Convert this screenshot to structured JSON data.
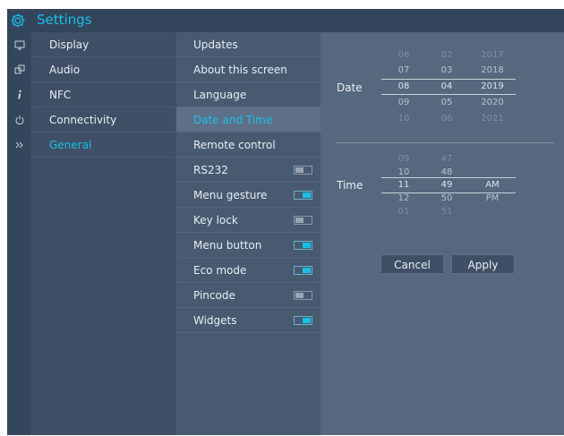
{
  "app": {
    "title": "Settings",
    "title_icon": "gear-icon",
    "accent_color": "#18c0e8"
  },
  "rail": [
    {
      "icon": "display-icon"
    },
    {
      "icon": "audio-icon"
    },
    {
      "icon": "info-icon"
    },
    {
      "icon": "power-icon"
    },
    {
      "icon": "chevron-double-right-icon"
    }
  ],
  "categories": [
    {
      "label": "Display"
    },
    {
      "label": "Audio"
    },
    {
      "label": "NFC"
    },
    {
      "label": "Connectivity"
    },
    {
      "label": "General",
      "active": true
    }
  ],
  "general_items": [
    {
      "label": "Updates"
    },
    {
      "label": "About this screen"
    },
    {
      "label": "Language"
    },
    {
      "label": "Date and Time",
      "active": true
    },
    {
      "label": "Remote control"
    },
    {
      "label": "RS232",
      "toggle": "off"
    },
    {
      "label": "Menu gesture",
      "toggle": "on"
    },
    {
      "label": "Key lock",
      "toggle": "off"
    },
    {
      "label": "Menu button",
      "toggle": "on"
    },
    {
      "label": "Eco mode",
      "toggle": "on"
    },
    {
      "label": "Pincode",
      "toggle": "off"
    },
    {
      "label": "Widgets",
      "toggle": "on"
    }
  ],
  "date_picker": {
    "label": "Date",
    "columns": [
      [
        "06",
        "07",
        "08",
        "09",
        "10"
      ],
      [
        "02",
        "03",
        "04",
        "05",
        "06"
      ],
      [
        "2017",
        "2018",
        "2019",
        "2020",
        "2021"
      ]
    ],
    "selected": [
      "08",
      "04",
      "2019"
    ]
  },
  "time_picker": {
    "label": "Time",
    "columns": [
      [
        "09",
        "10",
        "11",
        "12",
        "01"
      ],
      [
        "47",
        "48",
        "49",
        "50",
        "51"
      ],
      [
        "",
        "",
        "AM",
        "PM",
        ""
      ]
    ],
    "selected": [
      "11",
      "49",
      "AM"
    ]
  },
  "buttons": {
    "cancel": "Cancel",
    "apply": "Apply"
  }
}
